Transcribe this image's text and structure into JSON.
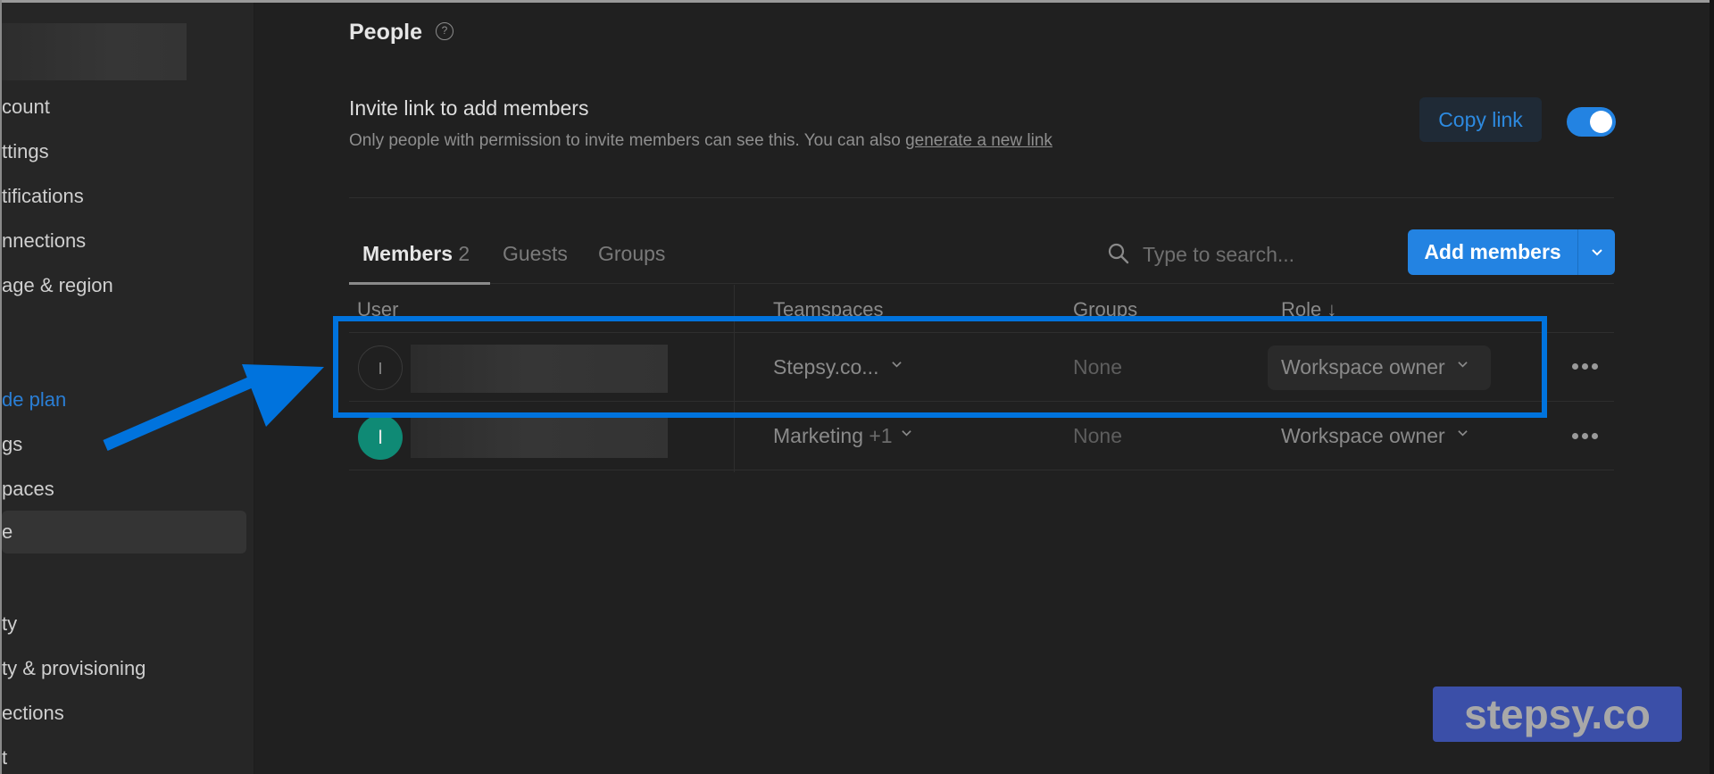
{
  "sidebar": {
    "items": [
      {
        "label": "count",
        "state": "normal"
      },
      {
        "label": "ttings",
        "state": "normal"
      },
      {
        "label": "tifications",
        "state": "normal"
      },
      {
        "label": "nnections",
        "state": "normal"
      },
      {
        "label": "age & region",
        "state": "normal"
      },
      {
        "label": "de plan",
        "state": "link"
      },
      {
        "label": "gs",
        "state": "normal"
      },
      {
        "label": "paces",
        "state": "normal"
      },
      {
        "label": "e",
        "state": "active"
      },
      {
        "label": "ty",
        "state": "normal"
      },
      {
        "label": "ty & provisioning",
        "state": "normal"
      },
      {
        "label": "ections",
        "state": "normal"
      },
      {
        "label": "t",
        "state": "normal"
      }
    ]
  },
  "header": {
    "title": "People",
    "help_icon": "?"
  },
  "invite": {
    "title": "Invite link to add members",
    "description": "Only people with permission to invite members can see this. You can also ",
    "link_text": "generate a new link",
    "copy_link_label": "Copy link",
    "toggle_on": true
  },
  "tabs": [
    {
      "label": "Members",
      "count": "2",
      "active": true
    },
    {
      "label": "Guests",
      "active": false
    },
    {
      "label": "Groups",
      "active": false
    }
  ],
  "search": {
    "placeholder": "Type to search...",
    "value": ""
  },
  "add_members": {
    "label": "Add members"
  },
  "table": {
    "columns": [
      "User",
      "Teamspaces",
      "Groups",
      "Role ↓"
    ],
    "rows": [
      {
        "avatar_initial": "I",
        "avatar_style": "outline",
        "teamspaces": "Stepsy.co...",
        "teamspaces_extra": "",
        "groups": "None",
        "role": "Workspace owner"
      },
      {
        "avatar_initial": "I",
        "avatar_style": "filled",
        "teamspaces": "Marketing",
        "teamspaces_extra": "+1",
        "groups": "None",
        "role": "Workspace owner"
      }
    ]
  },
  "colors": {
    "accent": "#2383e2",
    "annotation": "#0073dd",
    "background": "#202020",
    "sidebar": "#262626",
    "avatar_green": "#0f8a75",
    "watermark_bg": "#3b4fa8"
  },
  "watermark": {
    "text": "stepsy.co"
  }
}
